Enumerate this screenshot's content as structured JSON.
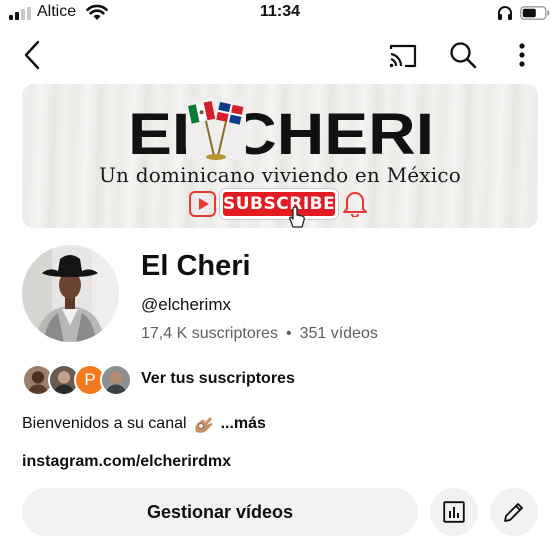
{
  "status_bar": {
    "carrier": "Altice",
    "time": "11:34"
  },
  "header": {
    "back_icon": "back-arrow-icon",
    "cast_icon": "cast-icon",
    "search_icon": "search-icon",
    "more_icon": "more-vertical-icon"
  },
  "banner": {
    "title": "EL CHERI",
    "tagline": "Un dominicano viviendo en México",
    "subscribe_label": "SUBSCRIBE"
  },
  "channel": {
    "name": "El Cheri",
    "handle": "@elcherimx",
    "subscribers": "17,4 K suscriptores",
    "separator": "•",
    "videos": "351 vídeos"
  },
  "subscribers_row": {
    "link_label": "Ver tus suscriptores",
    "avatar_letter": "P"
  },
  "description": {
    "text": "Bienvenidos a su canal",
    "more": "...más",
    "link": "instagram.com/elcherirdmx"
  },
  "actions": {
    "manage_label": "Gestionar vídeos",
    "analytics_icon": "analytics-icon",
    "edit_icon": "pencil-icon"
  },
  "colors": {
    "subscribe_red": "#e31b23",
    "secondary_text": "#606060",
    "button_bg": "#f2f2f2"
  }
}
